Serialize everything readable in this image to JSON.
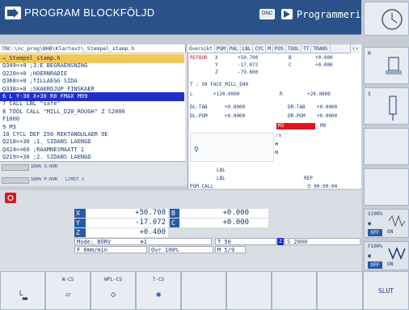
{
  "header": {
    "mode_title": "PROGRAM BLOCKFÖLJD",
    "dnc_label": "DNC",
    "mode2_title": "Programmering"
  },
  "program": {
    "path": "TNC:\\nc_prog\\BHB\\Klartext\\_Stempel_stamp.h",
    "lines": [
      {
        "text": "→_Stempel_stamp.h",
        "style": "first"
      },
      {
        "text": "   Q349=+0     ;3:E BEGRAENSNING",
        "style": "normal"
      },
      {
        "text": "   Q220=+0     ;HOERNRADIE",
        "style": "normal"
      },
      {
        "text": "   Q368=+0     ;TILLAEGG SIDA",
        "style": "normal"
      },
      {
        "text": "   Q338=+0     ;SKAERDJUP FINSKAER",
        "style": "normal"
      },
      {
        "text": "6  L  Y-30  X+30 R0 FMAX M99",
        "style": "selected"
      },
      {
        "text": "7  CALL LBL \"safe\"",
        "style": "normal"
      },
      {
        "text": "8  TOOL CALL \"MILL_D20_ROUGH\" Z S2000",
        "style": "normal"
      },
      {
        "text": "   F1000",
        "style": "normal"
      },
      {
        "text": "9  M3",
        "style": "normal"
      },
      {
        "text": "10 CYCL DEF 256 REKTANGULAER OE",
        "style": "normal"
      },
      {
        "text": "   Q218=+30    ;1. SIDANS LAENGD",
        "style": "normal"
      },
      {
        "text": "   Q424=+60    ;RAAMNESMAATT 1",
        "style": "normal"
      },
      {
        "text": "   Q219=+30    ;2. SIDANS LAENGD",
        "style": "normal"
      }
    ],
    "s_ovr_label": "100% S-OVR",
    "f_ovr_label": "100% F-OVR",
    "limit_label": "LIMIT 1"
  },
  "status": {
    "tabs": [
      "Översikt",
      "PGM",
      "PAL",
      "LBL",
      "CYC",
      "M",
      "POS",
      "TOOL",
      "TT",
      "TRANS"
    ],
    "refbor_label": "REFBÖR",
    "refbor": [
      {
        "axis": "X",
        "value": "+50.700",
        "axis2": "B",
        "value2": "+0.000"
      },
      {
        "axis": "Y",
        "value": "-17.072",
        "axis2": "C",
        "value2": "+0.000"
      },
      {
        "axis": "Z",
        "value": "-79.600",
        "axis2": "",
        "value2": ""
      }
    ],
    "tool_line": "T :  50      FACE_MILL_D40",
    "l_label": "L",
    "l_value": "+120.0000",
    "r_label": "R",
    "r_value": "+20.0000",
    "dl_tab": {
      "label": "DL-TAB",
      "value": "+0.0000",
      "label2": "DR-TAB",
      "value2": "+0.0000"
    },
    "dl_pgm": {
      "label": "DL-PGM",
      "value": "+0.0000",
      "label2": "DR-PGM",
      "value2": "+0.0000"
    },
    "m3_label": "M3",
    "m9_label": "M9",
    "lbl1": "LBL",
    "lbl2": "LBL",
    "rep_label": "REP",
    "pgm_call_label": "PGM CALL",
    "timer": "00:00:04",
    "active_pgm": "Aktivt PGM: TNC:\\nc_prog\\...\\_Stempel_stamp.h"
  },
  "positions": {
    "rows": [
      {
        "axis": "X",
        "value": "+50.708",
        "axis2": "B",
        "value2": "+0.000"
      },
      {
        "axis": "Y",
        "value": "-17.072",
        "axis2": "C",
        "value2": "+0.000"
      },
      {
        "axis": "Z",
        "value": "+0.400",
        "axis2": "",
        "value2": ""
      }
    ],
    "mode_label": "Mode: BÖRV",
    "tool_axis": "T 50",
    "spindle": "S 2000",
    "feed": "F  0mm/min",
    "ovr": "Ovr 100%",
    "m_label": "M 5/9"
  },
  "right_softkeys": {
    "s100": "S100%",
    "off1": "OFF",
    "on1": "ON",
    "f100": "F100%",
    "off2": "OFF",
    "on2": "ON"
  },
  "bottom_softkeys": [
    "",
    "W-CS",
    "WPL-CS",
    "T-CS",
    "",
    "",
    "",
    "",
    "SLUT"
  ],
  "colors": {
    "accent": "#2a5289",
    "axis_blue": "#2a5aa8",
    "selected": "#1f2fc8",
    "red": "#e0141e"
  }
}
